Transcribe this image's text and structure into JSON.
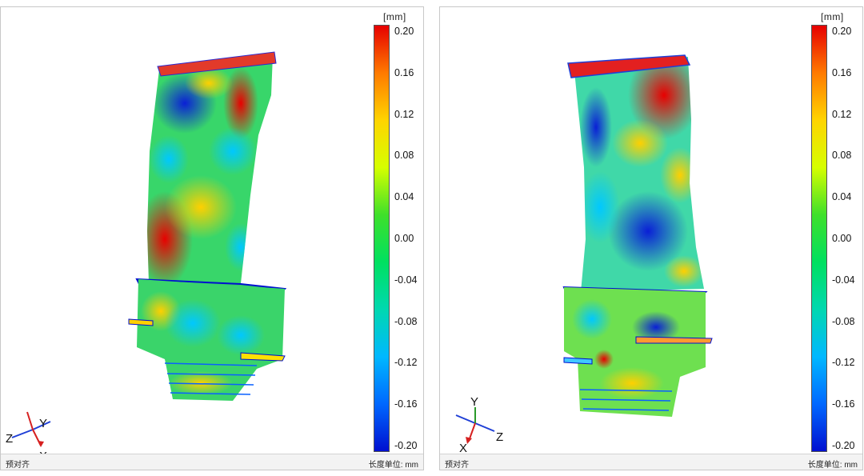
{
  "views": [
    {
      "unit": "[mm]",
      "scale_ticks": [
        "0.20",
        "0.16",
        "0.12",
        "0.08",
        "0.04",
        "0.00",
        "-0.04",
        "-0.08",
        "-0.12",
        "-0.16",
        "-0.20"
      ],
      "axis_labels": {
        "z": "Z",
        "y": "Y",
        "x": "X"
      },
      "status_left": "预对齐",
      "status_right": "长度单位: mm"
    },
    {
      "unit": "[mm]",
      "scale_ticks": [
        "0.20",
        "0.16",
        "0.12",
        "0.08",
        "0.04",
        "0.00",
        "-0.04",
        "-0.08",
        "-0.12",
        "-0.16",
        "-0.20"
      ],
      "axis_labels": {
        "y": "Y",
        "z": "Z",
        "x": "X"
      },
      "status_left": "预对齐",
      "status_right": "长度单位: mm"
    }
  ],
  "colors": {
    "scale": [
      "#e60000",
      "#ff7a00",
      "#ffd400",
      "#d6ff00",
      "#3fe02a",
      "#00e060",
      "#00d8b0",
      "#00b8ff",
      "#0068ff",
      "#0010d0"
    ],
    "axis_x": "#d62020",
    "axis_y": "#2a9a2a",
    "axis_z": "#1f3fd6"
  }
}
